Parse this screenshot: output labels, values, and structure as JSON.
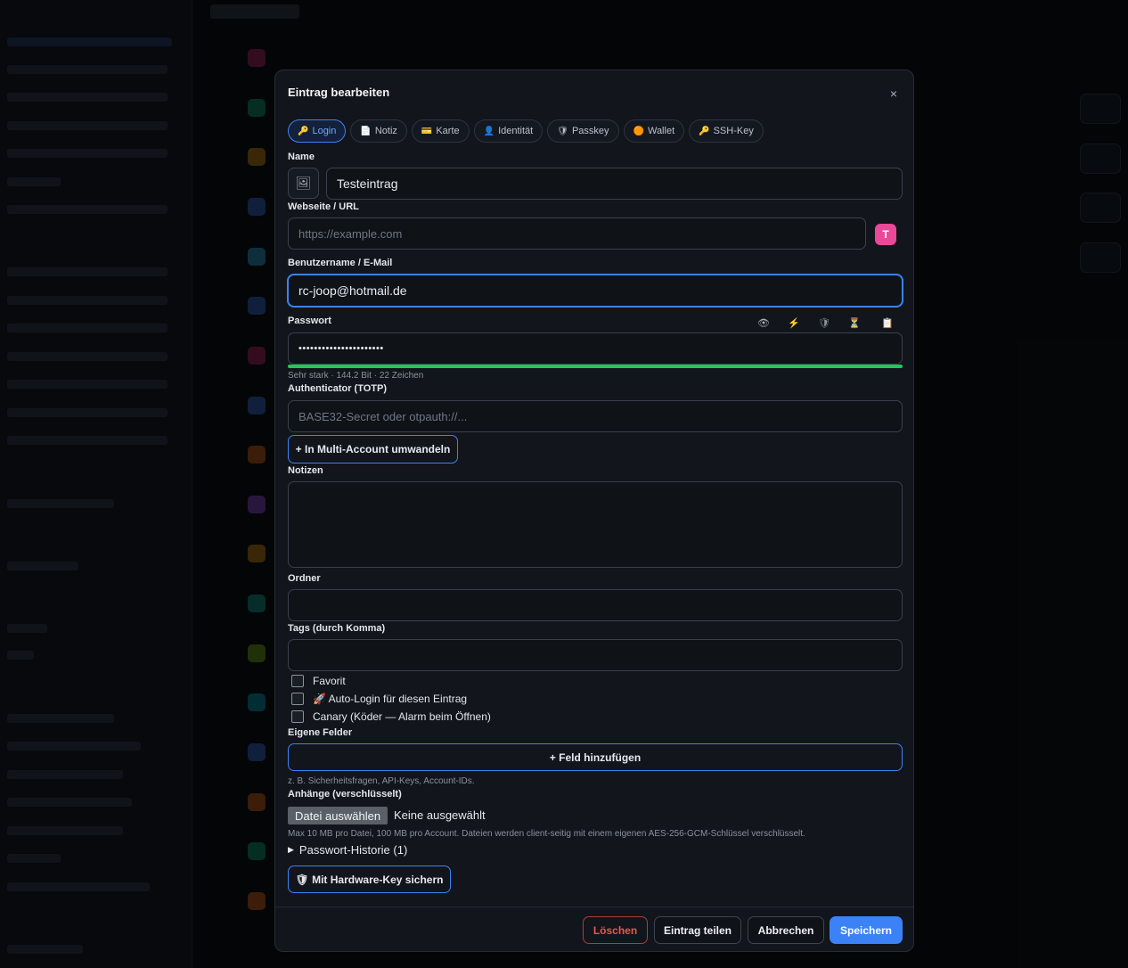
{
  "modal": {
    "title": "Eintrag bearbeiten",
    "close": "×",
    "tabs": [
      {
        "label": "Login",
        "icon": "🔑"
      },
      {
        "label": "Notiz",
        "icon": "📄"
      },
      {
        "label": "Karte",
        "icon": "💳"
      },
      {
        "label": "Identität",
        "icon": "👤"
      },
      {
        "label": "Passkey",
        "icon": "🛡"
      },
      {
        "label": "Wallet",
        "icon": "🟠"
      },
      {
        "label": "SSH-Key",
        "icon": "🔑"
      }
    ],
    "name": {
      "label": "Name",
      "value": "Testeintrag",
      "icon": "🖼"
    },
    "url": {
      "label": "Webseite / URL",
      "placeholder": "https://example.com",
      "avatar": "T"
    },
    "username": {
      "label": "Benutzername / E-Mail",
      "value": "rc-joop@hotmail.de"
    },
    "password": {
      "label": "Passwort",
      "value": "••••••••••••••••••••••",
      "strength_text": "Sehr stark · 144.2 Bit · 22 Zeichen",
      "strength_fraction": 1.0,
      "tools": [
        "👁",
        "⚡",
        "🛡",
        "⏳",
        "📋"
      ]
    },
    "totp": {
      "label": "Authenticator (TOTP)",
      "placeholder": "BASE32-Secret oder otpauth://..."
    },
    "multi_account_btn": "+ In Multi-Account umwandeln",
    "notes": {
      "label": "Notizen",
      "value": ""
    },
    "folder": {
      "label": "Ordner",
      "value": ""
    },
    "tags": {
      "label": "Tags (durch Komma)",
      "value": ""
    },
    "checkboxes": [
      {
        "label": "Favorit",
        "checked": false
      },
      {
        "label": "🚀 Auto-Login für diesen Eintrag",
        "checked": false
      },
      {
        "label": "Canary (Köder — Alarm beim Öffnen)",
        "checked": false
      }
    ],
    "custom_fields": {
      "label": "Eigene Felder",
      "add_btn": "+ Feld hinzufügen",
      "hint": "z. B. Sicherheitsfragen, API-Keys, Account-IDs."
    },
    "attachments": {
      "label": "Anhänge (verschlüsselt)",
      "choose_btn": "Datei auswählen",
      "none_text": "Keine ausgewählt",
      "hint": "Max 10 MB pro Datei, 100 MB pro Account. Dateien werden client-seitig mit einem eigenen AES-256-GCM-Schlüssel verschlüsselt."
    },
    "history": {
      "arrow": "▶",
      "label": "Passwort-Historie (1)"
    },
    "hardware_key_btn": "🛡 Mit Hardware-Key sichern",
    "footer": {
      "delete": "Löschen",
      "share": "Eintrag teilen",
      "cancel": "Abbrechen",
      "save": "Speichern"
    }
  },
  "colors": {
    "accent": "#3b82f6",
    "danger": "#ef5350",
    "strength": "#22c55e",
    "avatar": "#ec4899"
  }
}
